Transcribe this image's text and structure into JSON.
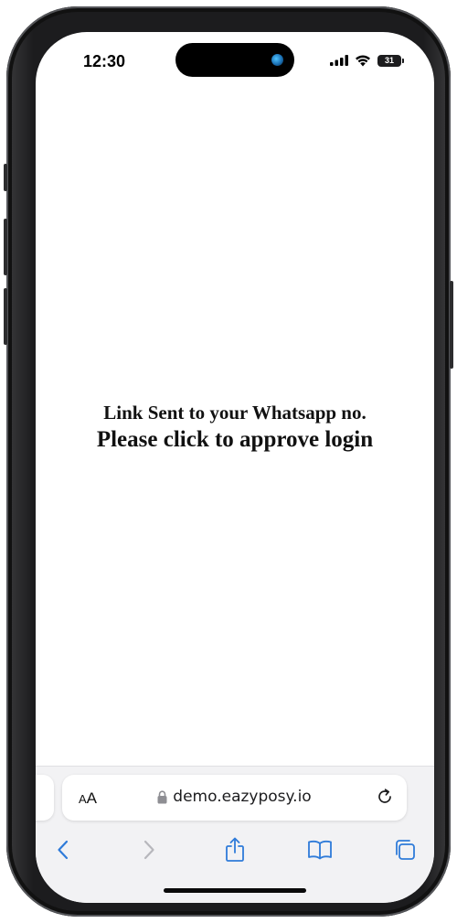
{
  "status_bar": {
    "time": "12:30",
    "battery": "31"
  },
  "message": {
    "line1": "Link Sent to your Whatsapp no.",
    "line2": "Please click to approve login"
  },
  "browser": {
    "text_size_small": "A",
    "text_size_large": "A",
    "url": "demo.eazyposy.io"
  },
  "colors": {
    "accent": "#2f7bd9",
    "disabled": "#b7b7bc"
  },
  "icons": {
    "back": "chevron-left-icon",
    "forward": "chevron-right-icon",
    "share": "share-icon",
    "bookmarks": "book-icon",
    "tabs": "tabs-icon",
    "lock": "lock-icon",
    "reload": "reload-icon"
  }
}
